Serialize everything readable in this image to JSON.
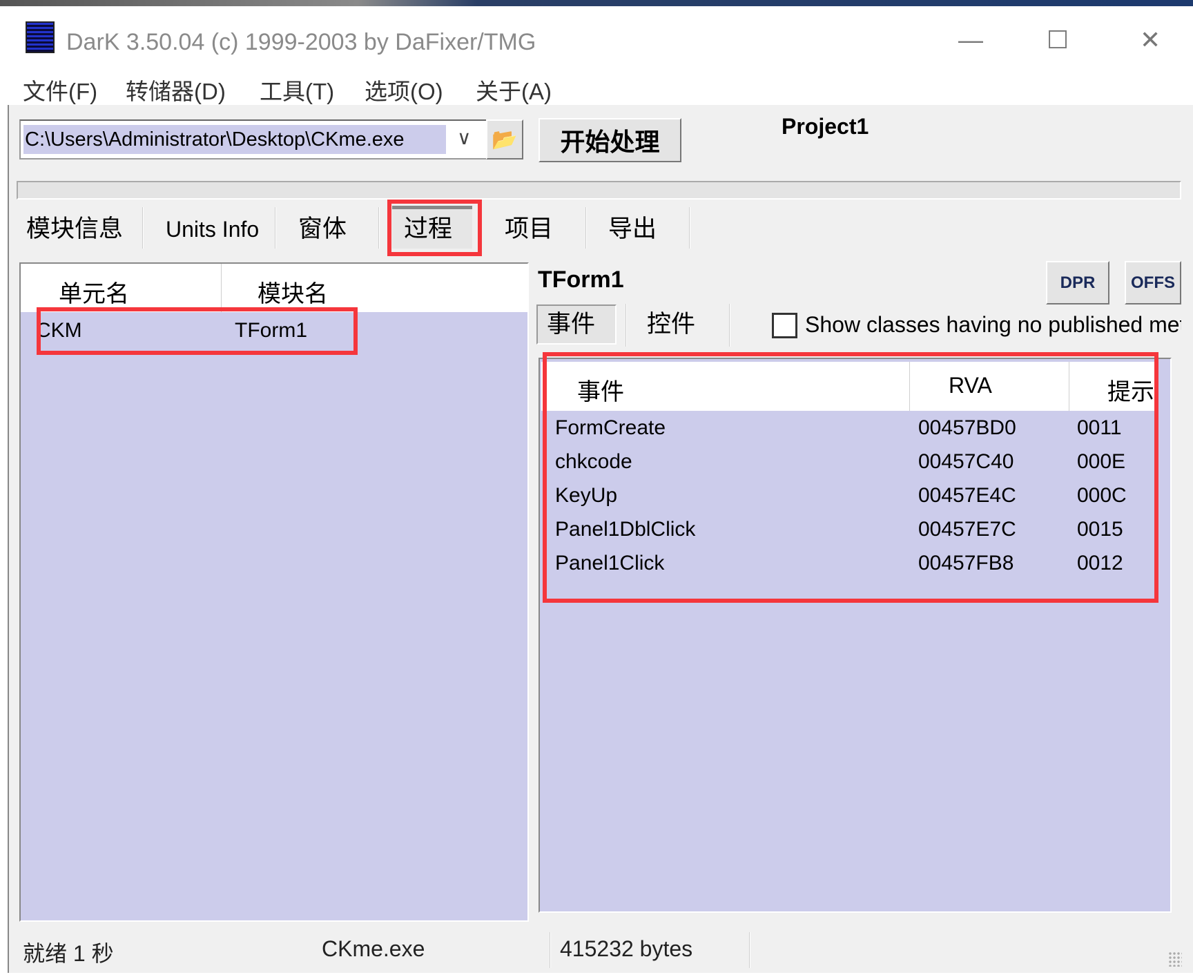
{
  "window": {
    "title": "DarK 3.50.04 (c) 1999-2003 by DaFixer/TMG",
    "minimize": "—",
    "maximize": "☐",
    "close": "✕"
  },
  "menu": [
    "文件(F)",
    "转储器(D)",
    "工具(T)",
    "选项(O)",
    "关于(A)"
  ],
  "toolbar": {
    "path": "C:\\Users\\Administrator\\Desktop\\CKme.exe",
    "dropdown_icon": "∨",
    "open_icon": "📂",
    "start_label": "开始处理",
    "project": "Project1"
  },
  "progress": 0,
  "tabs": [
    {
      "label": "模块信息"
    },
    {
      "label": "Units Info"
    },
    {
      "label": "窗体"
    },
    {
      "label": "过程",
      "selected": true
    },
    {
      "label": "项目"
    },
    {
      "label": "导出"
    }
  ],
  "units": {
    "columns": [
      "单元名",
      "模块名"
    ],
    "rows": [
      {
        "unit": "CKM",
        "module": "TForm1"
      }
    ]
  },
  "form": {
    "name": "TForm1",
    "dpr": "DPR",
    "offs": "OFFS",
    "subtabs": [
      {
        "label": "事件",
        "selected": true
      },
      {
        "label": "控件"
      }
    ],
    "show_classes_label": "Show classes having no published meth",
    "show_classes_checked": false,
    "columns": [
      "事件",
      "RVA",
      "提示"
    ],
    "events": [
      {
        "name": "FormCreate",
        "rva": "00457BD0",
        "hint": "0011"
      },
      {
        "name": "chkcode",
        "rva": "00457C40",
        "hint": "000E"
      },
      {
        "name": "KeyUp",
        "rva": "00457E4C",
        "hint": "000C"
      },
      {
        "name": "Panel1DblClick",
        "rva": "00457E7C",
        "hint": "0015"
      },
      {
        "name": "Panel1Click",
        "rva": "00457FB8",
        "hint": "0012"
      }
    ]
  },
  "status": {
    "state": "就绪 1 秒",
    "file": "CKme.exe",
    "size": "415232 bytes"
  },
  "colors": {
    "list_bg": "#cccceb",
    "highlight": "#f5363c"
  }
}
